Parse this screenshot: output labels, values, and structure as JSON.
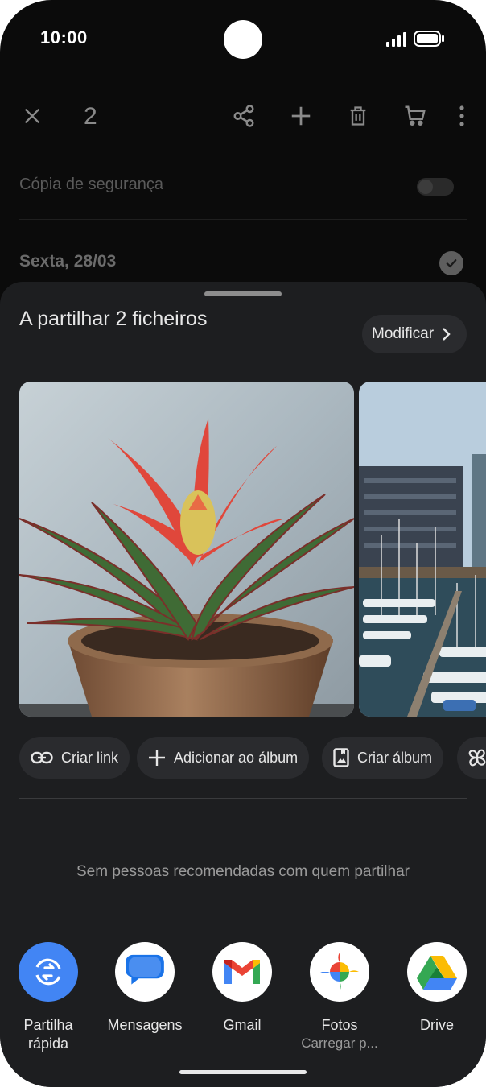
{
  "status_bar": {
    "time": "10:00"
  },
  "toolbar": {
    "selected_count": "2"
  },
  "background": {
    "backup_label": "Cópia de segurança",
    "date_header": "Sexta, 28/03"
  },
  "share_sheet": {
    "title": "A partilhar 2 ficheiros",
    "modify_label": "Modificar",
    "photos": [
      {
        "subject": "Red bromeliad plant in terracotta pot"
      },
      {
        "subject": "Marina with sailboats and buildings"
      }
    ],
    "chips": [
      "Criar link",
      "Adicionar ao álbum",
      "Criar álbum"
    ],
    "no_recommendations": "Sem pessoas recomendadas com quem partilhar",
    "apps": [
      {
        "label": "Partilha rápida",
        "icon": "quick-share-icon"
      },
      {
        "label": "Mensagens",
        "icon": "messages-icon"
      },
      {
        "label": "Gmail",
        "icon": "gmail-icon"
      },
      {
        "label": "Fotos",
        "sub": "Carregar p...",
        "icon": "photos-icon"
      },
      {
        "label": "Drive",
        "icon": "drive-icon"
      }
    ]
  },
  "colors": {
    "accent": "#4285f4",
    "sheet": "#1d1e20",
    "chip": "#2a2b2e"
  }
}
